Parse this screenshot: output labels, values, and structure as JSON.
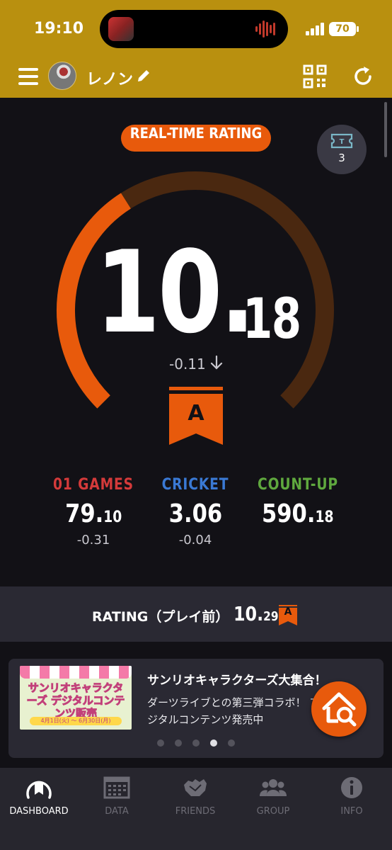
{
  "status_bar": {
    "time": "19:10",
    "battery": "70"
  },
  "header": {
    "user_name": "レノン",
    "icons": [
      "menu-icon",
      "edit-icon",
      "qr-code-icon",
      "refresh-icon"
    ]
  },
  "rating_card": {
    "badge": "REAL-TIME RATING",
    "ticket_count": "3",
    "rating_integer": "10.",
    "rating_decimal": "18",
    "delta": "-0.11",
    "grade": "A",
    "gauge_level": 0.38,
    "colors": {
      "accent": "#e85a0c",
      "track": "#4a2810"
    }
  },
  "stats": [
    {
      "label": "01 GAMES",
      "value_main": "79.",
      "value_small": "10",
      "delta": "-0.31",
      "color": "#d43a3a"
    },
    {
      "label": "CRICKET",
      "value_main": "3.06",
      "value_small": "",
      "delta": "-0.04",
      "color": "#3a79d4"
    },
    {
      "label": "COUNT-UP",
      "value_main": "590.",
      "value_small": "18",
      "delta": "",
      "color": "#5fa83e"
    }
  ],
  "pre_play": {
    "label": "RATING（プレイ前）",
    "value_main": "10.",
    "value_small": "29",
    "grade": "A"
  },
  "banner": {
    "image_title": "サンリオキャラクターズ デジタルコンテンツ販売",
    "image_date": "4月1日(火) ～ 6月30日(月)",
    "title": "サンリオキャラクターズ大集合！",
    "text": "ダーツライブとの第三弾コラボ！ アにてデジタルコンテンツ発売中",
    "page_count": 5,
    "active_page": 4
  },
  "tabs": [
    {
      "label": "DASHBOARD",
      "icon": "dashboard-icon",
      "active": true
    },
    {
      "label": "DATA",
      "icon": "calendar-icon",
      "active": false
    },
    {
      "label": "FRIENDS",
      "icon": "friends-icon",
      "active": false
    },
    {
      "label": "GROUP",
      "icon": "group-icon",
      "active": false
    },
    {
      "label": "INFO",
      "icon": "info-icon",
      "active": false
    }
  ]
}
